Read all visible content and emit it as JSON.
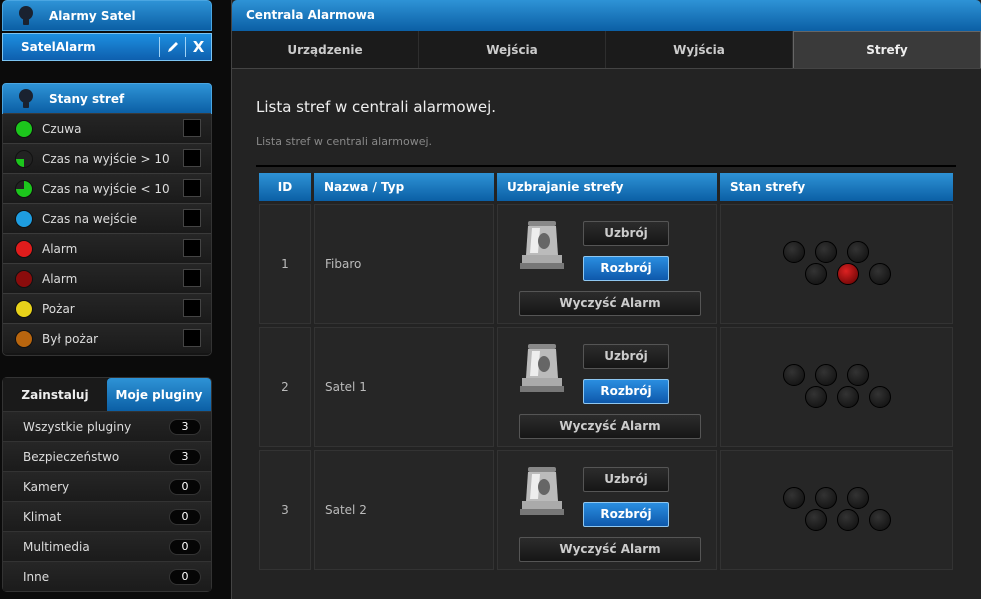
{
  "sidebar": {
    "header1": "Alarmy Satel",
    "app": {
      "name": "SatelAlarm"
    },
    "header2": "Stany stref",
    "states": [
      {
        "label": "Czuwa",
        "color": "#1cc61c",
        "type": "full"
      },
      {
        "label": "Czas na wyjście > 10",
        "color": "#1cc61c",
        "type": "quarter"
      },
      {
        "label": "Czas na wyjście < 10",
        "color": "#1cc61c",
        "type": "threequarter"
      },
      {
        "label": "Czas na wejście",
        "color": "#1e9de0",
        "type": "full"
      },
      {
        "label": "Alarm",
        "color": "#e01c1c",
        "type": "full"
      },
      {
        "label": "Alarm",
        "color": "#8a0c0c",
        "type": "full"
      },
      {
        "label": "Pożar",
        "color": "#e8d21a",
        "type": "full"
      },
      {
        "label": "Był pożar",
        "color": "#b8650e",
        "type": "full"
      }
    ],
    "tabs": {
      "install": "Zainstaluj",
      "mine": "Moje pluginy"
    },
    "plugins": [
      {
        "label": "Wszystkie pluginy",
        "count": "3"
      },
      {
        "label": "Bezpieczeństwo",
        "count": "3"
      },
      {
        "label": "Kamery",
        "count": "0"
      },
      {
        "label": "Klimat",
        "count": "0"
      },
      {
        "label": "Multimedia",
        "count": "0"
      },
      {
        "label": "Inne",
        "count": "0"
      }
    ]
  },
  "main": {
    "title": "Centrala Alarmowa",
    "tabs": [
      "Urządzenie",
      "Wejścia",
      "Wyjścia",
      "Strefy"
    ],
    "heading": "Lista stref w centrali alarmowej.",
    "subheading": "Lista stref w centrali alarmowej.",
    "table": {
      "headers": [
        "ID",
        "Nazwa / Typ",
        "Uzbrajanie strefy",
        "Stan strefy"
      ],
      "arm_label": "Uzbrój",
      "disarm_label": "Rozbrój",
      "clear_label": "Wyczyść Alarm",
      "rows": [
        {
          "id": "1",
          "name": "Fibaro",
          "active_led": 4
        },
        {
          "id": "2",
          "name": "Satel 1",
          "active_led": -1
        },
        {
          "id": "3",
          "name": "Satel 2",
          "active_led": -1
        }
      ]
    }
  }
}
